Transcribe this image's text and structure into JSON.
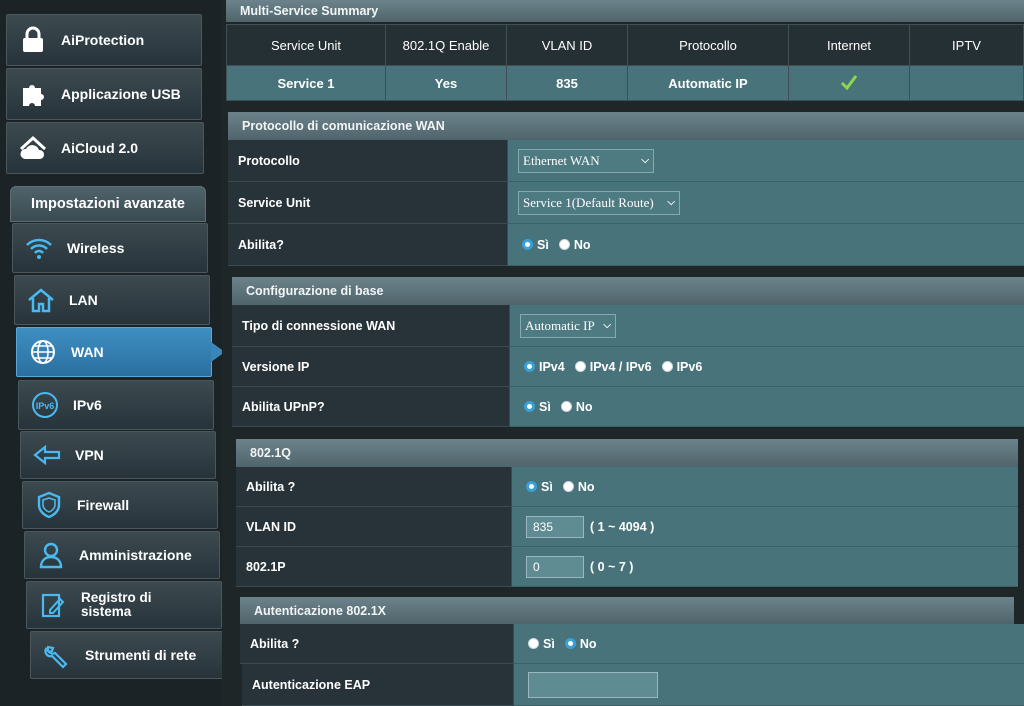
{
  "sidebar": {
    "top_items": [
      {
        "label": "AiProtection",
        "icon": "lock-icon"
      },
      {
        "label": "Applicazione USB",
        "icon": "puzzle-icon"
      },
      {
        "label": "AiCloud 2.0",
        "icon": "cloud-icon"
      }
    ],
    "advanced_header": "Impostazioni avanzate",
    "items": [
      {
        "label": "Wireless",
        "icon": "wifi-icon"
      },
      {
        "label": "LAN",
        "icon": "home-icon"
      },
      {
        "label": "WAN",
        "icon": "globe-icon",
        "active": true
      },
      {
        "label": "IPv6",
        "icon": "ipv6-icon"
      },
      {
        "label": "VPN",
        "icon": "vpn-icon"
      },
      {
        "label": "Firewall",
        "icon": "shield-icon"
      },
      {
        "label": "Amministrazione",
        "icon": "user-icon"
      },
      {
        "label": "Registro di sistema",
        "label_line1": "Registro di",
        "label_line2": "sistema",
        "icon": "log-icon"
      },
      {
        "label": "Strumenti di rete",
        "icon": "tools-icon"
      }
    ]
  },
  "summary": {
    "title": "Multi-Service Summary",
    "columns": [
      "Service Unit",
      "802.1Q Enable",
      "VLAN ID",
      "Protocollo",
      "Internet",
      "IPTV"
    ],
    "rows": [
      {
        "service_unit": "Service 1",
        "enable": "Yes",
        "vlan_id": "835",
        "protocol": "Automatic IP",
        "internet_icon": "check-icon",
        "iptv": ""
      }
    ]
  },
  "wan_protocol": {
    "title": "Protocollo di comunicazione WAN",
    "protocol_label": "Protocollo",
    "protocol_value": "Ethernet WAN",
    "service_unit_label": "Service Unit",
    "service_unit_value": "Service 1(Default Route)",
    "enable_label": "Abilita?",
    "yes": "Sì",
    "no": "No",
    "enable_selected": "yes"
  },
  "basic_config": {
    "title": "Configurazione di base",
    "conn_type_label": "Tipo di connessione WAN",
    "conn_type_value": "Automatic IP",
    "ip_version_label": "Versione IP",
    "ip_options": [
      "IPv4",
      "IPv4 / IPv6",
      "IPv6"
    ],
    "ip_selected": "IPv4",
    "upnp_label": "Abilita UPnP?",
    "yes": "Sì",
    "no": "No",
    "upnp_selected": "yes"
  },
  "dot1q": {
    "title": "802.1Q",
    "enable_label": "Abilita ?",
    "yes": "Sì",
    "no": "No",
    "enable_selected": "yes",
    "vlan_label": "VLAN ID",
    "vlan_value": "835",
    "vlan_range": "( 1 ~ 4094 )",
    "p_label": "802.1P",
    "p_value": "0",
    "p_range": "( 0 ~ 7 )"
  },
  "dot1x": {
    "title": "Autenticazione 802.1X",
    "enable_label": "Abilita ?",
    "yes": "Sì",
    "no": "No",
    "enable_selected": "no",
    "eap_label": "Autenticazione EAP",
    "eap_value": ""
  },
  "colors": {
    "accent_blue": "#3aa0d8",
    "value_teal": "#49737b",
    "label_dark": "#273338",
    "check_green": "#8ed64a"
  }
}
